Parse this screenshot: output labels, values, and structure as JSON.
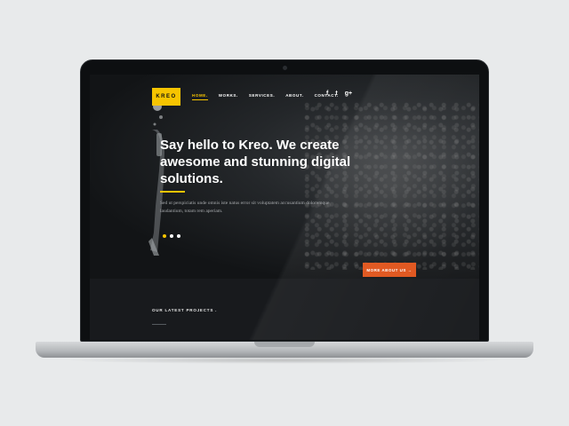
{
  "brand": {
    "logo_text": "KREO",
    "accent_color": "#f7c400",
    "button_color": "#e0531a"
  },
  "nav": {
    "items": [
      {
        "label": "HOME.",
        "active": true
      },
      {
        "label": "WORKS.",
        "active": false
      },
      {
        "label": "SERVICES.",
        "active": false
      },
      {
        "label": "ABOUT.",
        "active": false
      },
      {
        "label": "CONTACT.",
        "active": false
      }
    ]
  },
  "social": {
    "icons": [
      "facebook-icon",
      "twitter-icon",
      "google-plus-icon"
    ],
    "glyphs": [
      "f",
      "t",
      "g+"
    ]
  },
  "hero": {
    "headline": "Say hello to Kreo. We create awesome and stunning digital solutions.",
    "subtext": "Sed ut perspiciatis unde omnis iste natus error sit voluptatem accusantium doloremque laudantium, totam rem aperiam.",
    "slides": 3,
    "active_slide": 1,
    "cta_label": "MORE ABOUT US  →"
  },
  "projects": {
    "title": "OUR LATEST PROJECTS ."
  }
}
